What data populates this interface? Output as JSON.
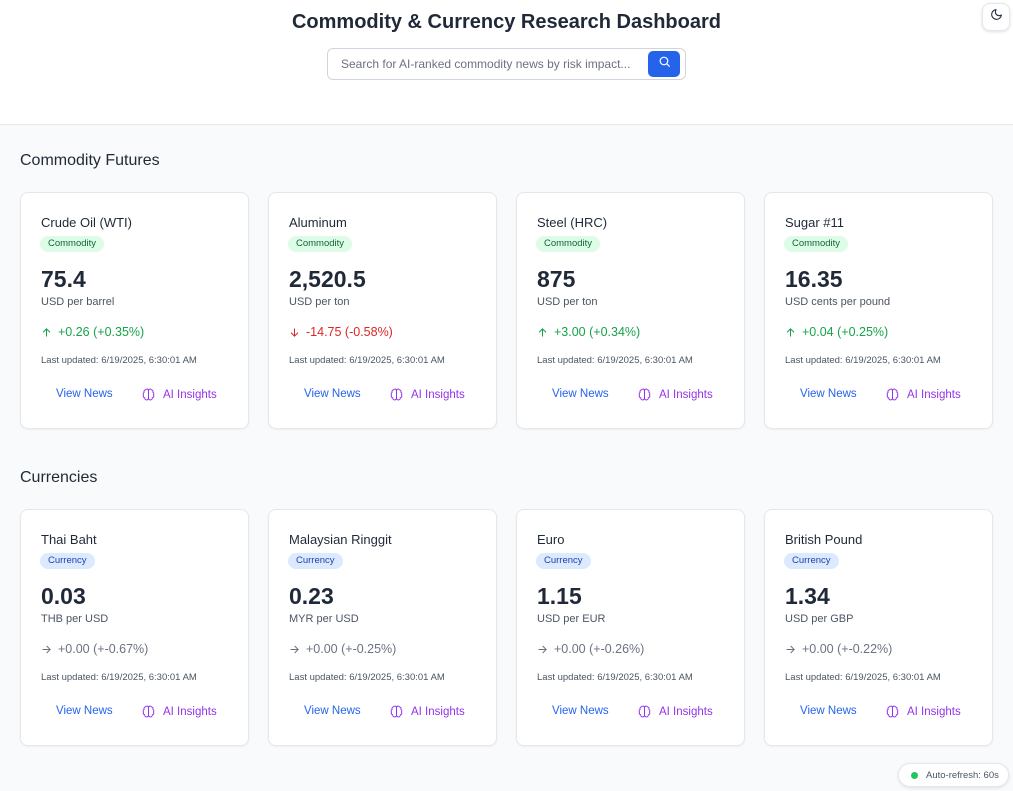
{
  "header": {
    "title": "Commodity & Currency Research Dashboard",
    "search_placeholder": "Search for AI-ranked commodity news by risk impact..."
  },
  "commodities": {
    "section_title": "Commodity Futures",
    "cards": [
      {
        "name": "Crude Oil (WTI)",
        "badge": "Commodity",
        "price": "75.4",
        "unit": "USD per barrel",
        "change": "+0.26 (+0.35%)",
        "direction": "up",
        "updated": "Last updated: 6/19/2025, 6:30:01 AM",
        "view_news": "View News",
        "ai_insights": "AI Insights"
      },
      {
        "name": "Aluminum",
        "badge": "Commodity",
        "price": "2,520.5",
        "unit": "USD per ton",
        "change": "-14.75 (-0.58%)",
        "direction": "down",
        "updated": "Last updated: 6/19/2025, 6:30:01 AM",
        "view_news": "View News",
        "ai_insights": "AI Insights"
      },
      {
        "name": "Steel (HRC)",
        "badge": "Commodity",
        "price": "875",
        "unit": "USD per ton",
        "change": "+3.00 (+0.34%)",
        "direction": "up",
        "updated": "Last updated: 6/19/2025, 6:30:01 AM",
        "view_news": "View News",
        "ai_insights": "AI Insights"
      },
      {
        "name": "Sugar #11",
        "badge": "Commodity",
        "price": "16.35",
        "unit": "USD cents per pound",
        "change": "+0.04 (+0.25%)",
        "direction": "up",
        "updated": "Last updated: 6/19/2025, 6:30:01 AM",
        "view_news": "View News",
        "ai_insights": "AI Insights"
      }
    ]
  },
  "currencies": {
    "section_title": "Currencies",
    "cards": [
      {
        "name": "Thai Baht",
        "badge": "Currency",
        "price": "0.03",
        "unit": "THB per USD",
        "change": "+0.00 (+-0.67%)",
        "direction": "flat",
        "updated": "Last updated: 6/19/2025, 6:30:01 AM",
        "view_news": "View News",
        "ai_insights": "AI Insights"
      },
      {
        "name": "Malaysian Ringgit",
        "badge": "Currency",
        "price": "0.23",
        "unit": "MYR per USD",
        "change": "+0.00 (+-0.25%)",
        "direction": "flat",
        "updated": "Last updated: 6/19/2025, 6:30:01 AM",
        "view_news": "View News",
        "ai_insights": "AI Insights"
      },
      {
        "name": "Euro",
        "badge": "Currency",
        "price": "1.15",
        "unit": "USD per EUR",
        "change": "+0.00 (+-0.26%)",
        "direction": "flat",
        "updated": "Last updated: 6/19/2025, 6:30:01 AM",
        "view_news": "View News",
        "ai_insights": "AI Insights"
      },
      {
        "name": "British Pound",
        "badge": "Currency",
        "price": "1.34",
        "unit": "USD per GBP",
        "change": "+0.00 (+-0.22%)",
        "direction": "flat",
        "updated": "Last updated: 6/19/2025, 6:30:01 AM",
        "view_news": "View News",
        "ai_insights": "AI Insights"
      }
    ]
  },
  "status": {
    "auto_refresh": "Auto-refresh: 60s"
  },
  "colors": {
    "accent": "#2563eb",
    "up": "#16a34a",
    "down": "#dc2626",
    "flat": "#6b7280",
    "ai": "#9333ea"
  },
  "icons": {
    "theme_toggle": "moon-icon",
    "search": "search-icon",
    "change_up": "arrow-up-icon",
    "change_down": "arrow-down-icon",
    "change_flat": "arrow-right-icon",
    "ai_insights": "brain-icon",
    "status": "status-dot-icon"
  }
}
